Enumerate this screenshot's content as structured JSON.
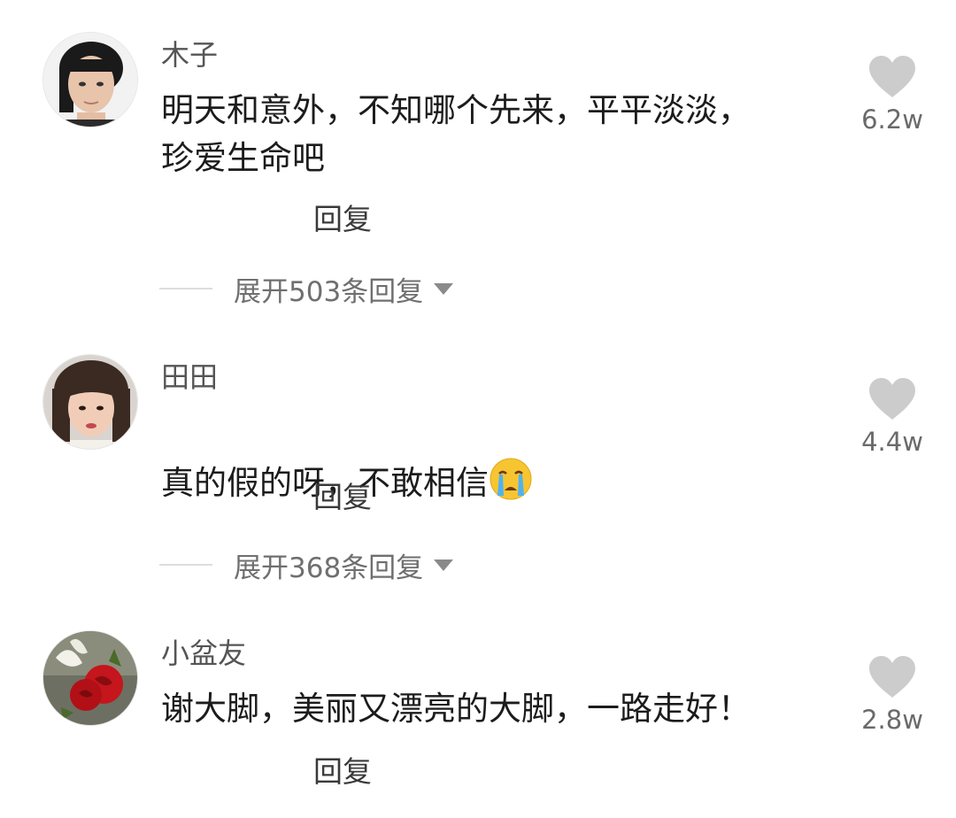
{
  "comments": [
    {
      "username": "木子",
      "text": "明天和意外，不知哪个先来，平平淡淡，\n珍爱生命吧",
      "likes": "6.2w",
      "reply_label": "回复",
      "expand_label": "展开503条回复"
    },
    {
      "username": "田田",
      "text": "真的假的呀，不敢相信",
      "emoji": "crying-face-icon",
      "likes": "4.4w",
      "reply_label": "回复",
      "expand_label": "展开368条回复"
    },
    {
      "username": "小盆友",
      "text": "谢大脚，美丽又漂亮的大脚，一路走好！",
      "likes": "2.8w",
      "reply_label": "回复"
    }
  ],
  "colors": {
    "heart": "#cccccc",
    "like_count": "#6a6a6a",
    "username": "#555555",
    "text": "#1c1c1c"
  }
}
